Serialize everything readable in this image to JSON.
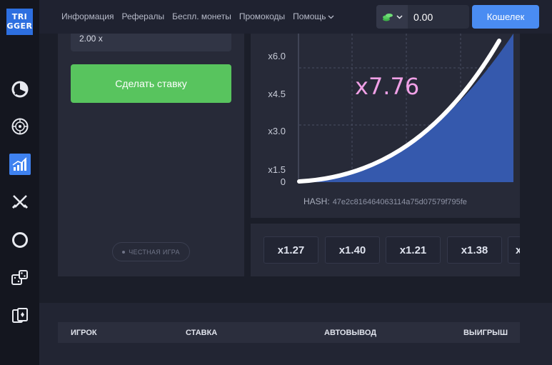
{
  "logo": {
    "line1": "TRI",
    "line2": "GGER"
  },
  "nav": {
    "items": [
      "Информация",
      "Рефералы",
      "Беспл. монеты",
      "Промокоды"
    ],
    "help": "Помощь"
  },
  "balance": {
    "value": "0.00"
  },
  "wallet_button": "Кошелек",
  "bet": {
    "input_value": "2.00 x",
    "button_label": "Сделать ставку",
    "fair_game": "ЧЕСТНАЯ ИГРА"
  },
  "graph": {
    "multiplier": "x7.76",
    "hash_label": "HASH:",
    "hash_value": "47e2c816464063114a75d07579f795fe",
    "y_ticks": [
      "x6.0",
      "x4.5",
      "x3.0",
      "x1.5",
      "0"
    ]
  },
  "history": [
    "x1.27",
    "x1.40",
    "x1.21",
    "x1.38",
    "x"
  ],
  "table": {
    "headers": [
      "ИГРОК",
      "СТАВКА",
      "АВТОВЫВОД",
      "ВЫИГРЫШ"
    ]
  },
  "colors": {
    "accent": "#4a8cf2",
    "bet_button": "#58c45e",
    "multiplier": "#f0a0e6",
    "curve_fill": "#3559ad"
  }
}
